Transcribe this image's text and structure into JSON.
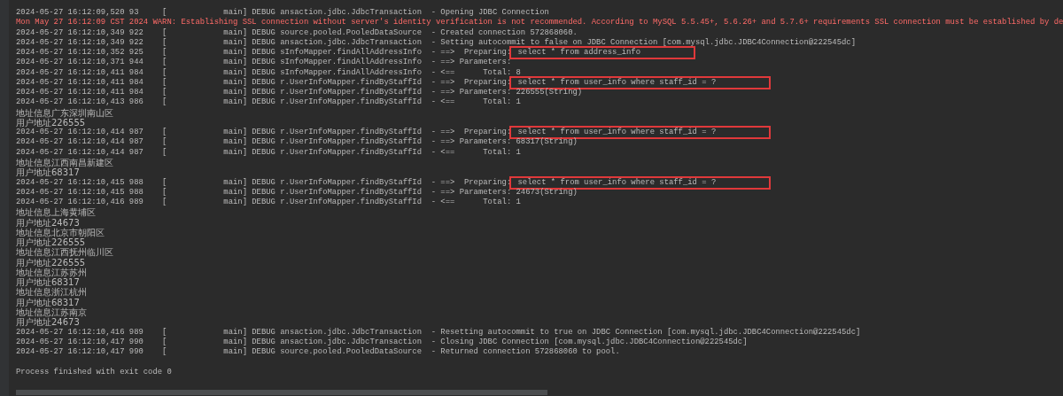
{
  "console": {
    "lines": [
      {
        "kind": "log",
        "text": "2024-05-27 16:12:09,520 93     [            main] DEBUG ansaction.jdbc.JdbcTransaction  - Opening JDBC Connection"
      },
      {
        "kind": "warn",
        "text": "Mon May 27 16:12:09 CST 2024 WARN: Establishing SSL connection without server's identity verification is not recommended. According to MySQL 5.5.45+, 5.6.26+ and 5.7.6+ requirements SSL connection must be established by de"
      },
      {
        "kind": "log",
        "text": "2024-05-27 16:12:10,349 922    [            main] DEBUG source.pooled.PooledDataSource  - Created connection 572868060."
      },
      {
        "kind": "log",
        "text": "2024-05-27 16:12:10,349 922    [            main] DEBUG ansaction.jdbc.JdbcTransaction  - Setting autocommit to false on JDBC Connection [com.mysql.jdbc.JDBC4Connection@222545dc]"
      },
      {
        "kind": "log",
        "text": "2024-05-27 16:12:10,352 925    [            main] DEBUG sInfoMapper.findAllAddressInfo  - ==>  Preparing:",
        "sql": "select * from address_info",
        "highlighted": true
      },
      {
        "kind": "log",
        "text": "2024-05-27 16:12:10,371 944    [            main] DEBUG sInfoMapper.findAllAddressInfo  - ==> Parameters: "
      },
      {
        "kind": "log",
        "text": "2024-05-27 16:12:10,411 984    [            main] DEBUG sInfoMapper.findAllAddressInfo  - <==      Total: 8"
      },
      {
        "kind": "log",
        "text": "2024-05-27 16:12:10,411 984    [            main] DEBUG r.UserInfoMapper.findByStaffId  - ==>  Preparing:",
        "sql": "select * from user_info where staff_id = ?",
        "highlighted": true
      },
      {
        "kind": "log",
        "text": "2024-05-27 16:12:10,411 984    [            main] DEBUG r.UserInfoMapper.findByStaffId  - ==> Parameters: 226555(String)"
      },
      {
        "kind": "log",
        "text": "2024-05-27 16:12:10,413 986    [            main] DEBUG r.UserInfoMapper.findByStaffId  - <==      Total: 1"
      },
      {
        "kind": "output",
        "text": "地址信息广东深圳南山区"
      },
      {
        "kind": "output",
        "text": "用户地址226555"
      },
      {
        "kind": "log",
        "text": "2024-05-27 16:12:10,414 987    [            main] DEBUG r.UserInfoMapper.findByStaffId  - ==>  Preparing:",
        "sql": "select * from user_info where staff_id = ?",
        "highlighted": true
      },
      {
        "kind": "log",
        "text": "2024-05-27 16:12:10,414 987    [            main] DEBUG r.UserInfoMapper.findByStaffId  - ==> Parameters: 68317(String)"
      },
      {
        "kind": "log",
        "text": "2024-05-27 16:12:10,414 987    [            main] DEBUG r.UserInfoMapper.findByStaffId  - <==      Total: 1"
      },
      {
        "kind": "output",
        "text": "地址信息江西南昌新建区"
      },
      {
        "kind": "output",
        "text": "用户地址68317"
      },
      {
        "kind": "log",
        "text": "2024-05-27 16:12:10,415 988    [            main] DEBUG r.UserInfoMapper.findByStaffId  - ==>  Preparing:",
        "sql": "select * from user_info where staff_id = ?",
        "highlighted": true
      },
      {
        "kind": "log",
        "text": "2024-05-27 16:12:10,415 988    [            main] DEBUG r.UserInfoMapper.findByStaffId  - ==> Parameters: 24673(String)"
      },
      {
        "kind": "log",
        "text": "2024-05-27 16:12:10,416 989    [            main] DEBUG r.UserInfoMapper.findByStaffId  - <==      Total: 1"
      },
      {
        "kind": "output",
        "text": "地址信息上海黄埔区"
      },
      {
        "kind": "output",
        "text": "用户地址24673"
      },
      {
        "kind": "output",
        "text": "地址信息北京市朝阳区"
      },
      {
        "kind": "output",
        "text": "用户地址226555"
      },
      {
        "kind": "output",
        "text": "地址信息江西抚州临川区"
      },
      {
        "kind": "output",
        "text": "用户地址226555"
      },
      {
        "kind": "output",
        "text": "地址信息江苏苏州"
      },
      {
        "kind": "output",
        "text": "用户地址68317"
      },
      {
        "kind": "output",
        "text": "地址信息浙江杭州"
      },
      {
        "kind": "output",
        "text": "用户地址68317"
      },
      {
        "kind": "output",
        "text": "地址信息江苏南京"
      },
      {
        "kind": "output",
        "text": "用户地址24673"
      },
      {
        "kind": "log",
        "text": "2024-05-27 16:12:10,416 989    [            main] DEBUG ansaction.jdbc.JdbcTransaction  - Resetting autocommit to true on JDBC Connection [com.mysql.jdbc.JDBC4Connection@222545dc]"
      },
      {
        "kind": "log",
        "text": "2024-05-27 16:12:10,417 990    [            main] DEBUG ansaction.jdbc.JdbcTransaction  - Closing JDBC Connection [com.mysql.jdbc.JDBC4Connection@222545dc]"
      },
      {
        "kind": "log",
        "text": "2024-05-27 16:12:10,417 990    [            main] DEBUG source.pooled.PooledDataSource  - Returned connection 572868060 to pool."
      },
      {
        "kind": "exit",
        "text": "Process finished with exit code 0"
      }
    ]
  }
}
